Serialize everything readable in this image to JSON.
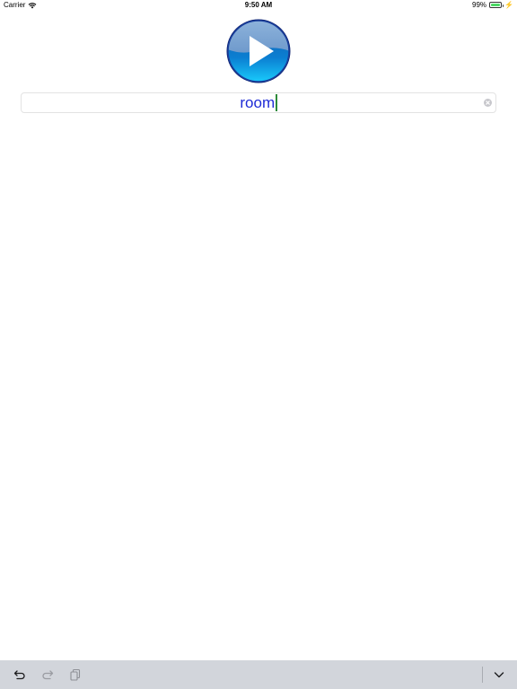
{
  "status_bar": {
    "carrier": "Carrier",
    "time": "9:50 AM",
    "battery_percent": "99%",
    "battery_level": 0.99
  },
  "search": {
    "value": "room"
  },
  "icons": {
    "play": "play-icon",
    "clear": "clear-icon",
    "undo": "undo-icon",
    "redo": "redo-icon",
    "paste": "paste-icon",
    "dismiss_keyboard": "chevron-down-icon"
  },
  "colors": {
    "input_text": "#1e2bd6",
    "caret": "#2d8a3a",
    "battery": "#4cd964",
    "toolbar_bg": "#d2d5db"
  }
}
